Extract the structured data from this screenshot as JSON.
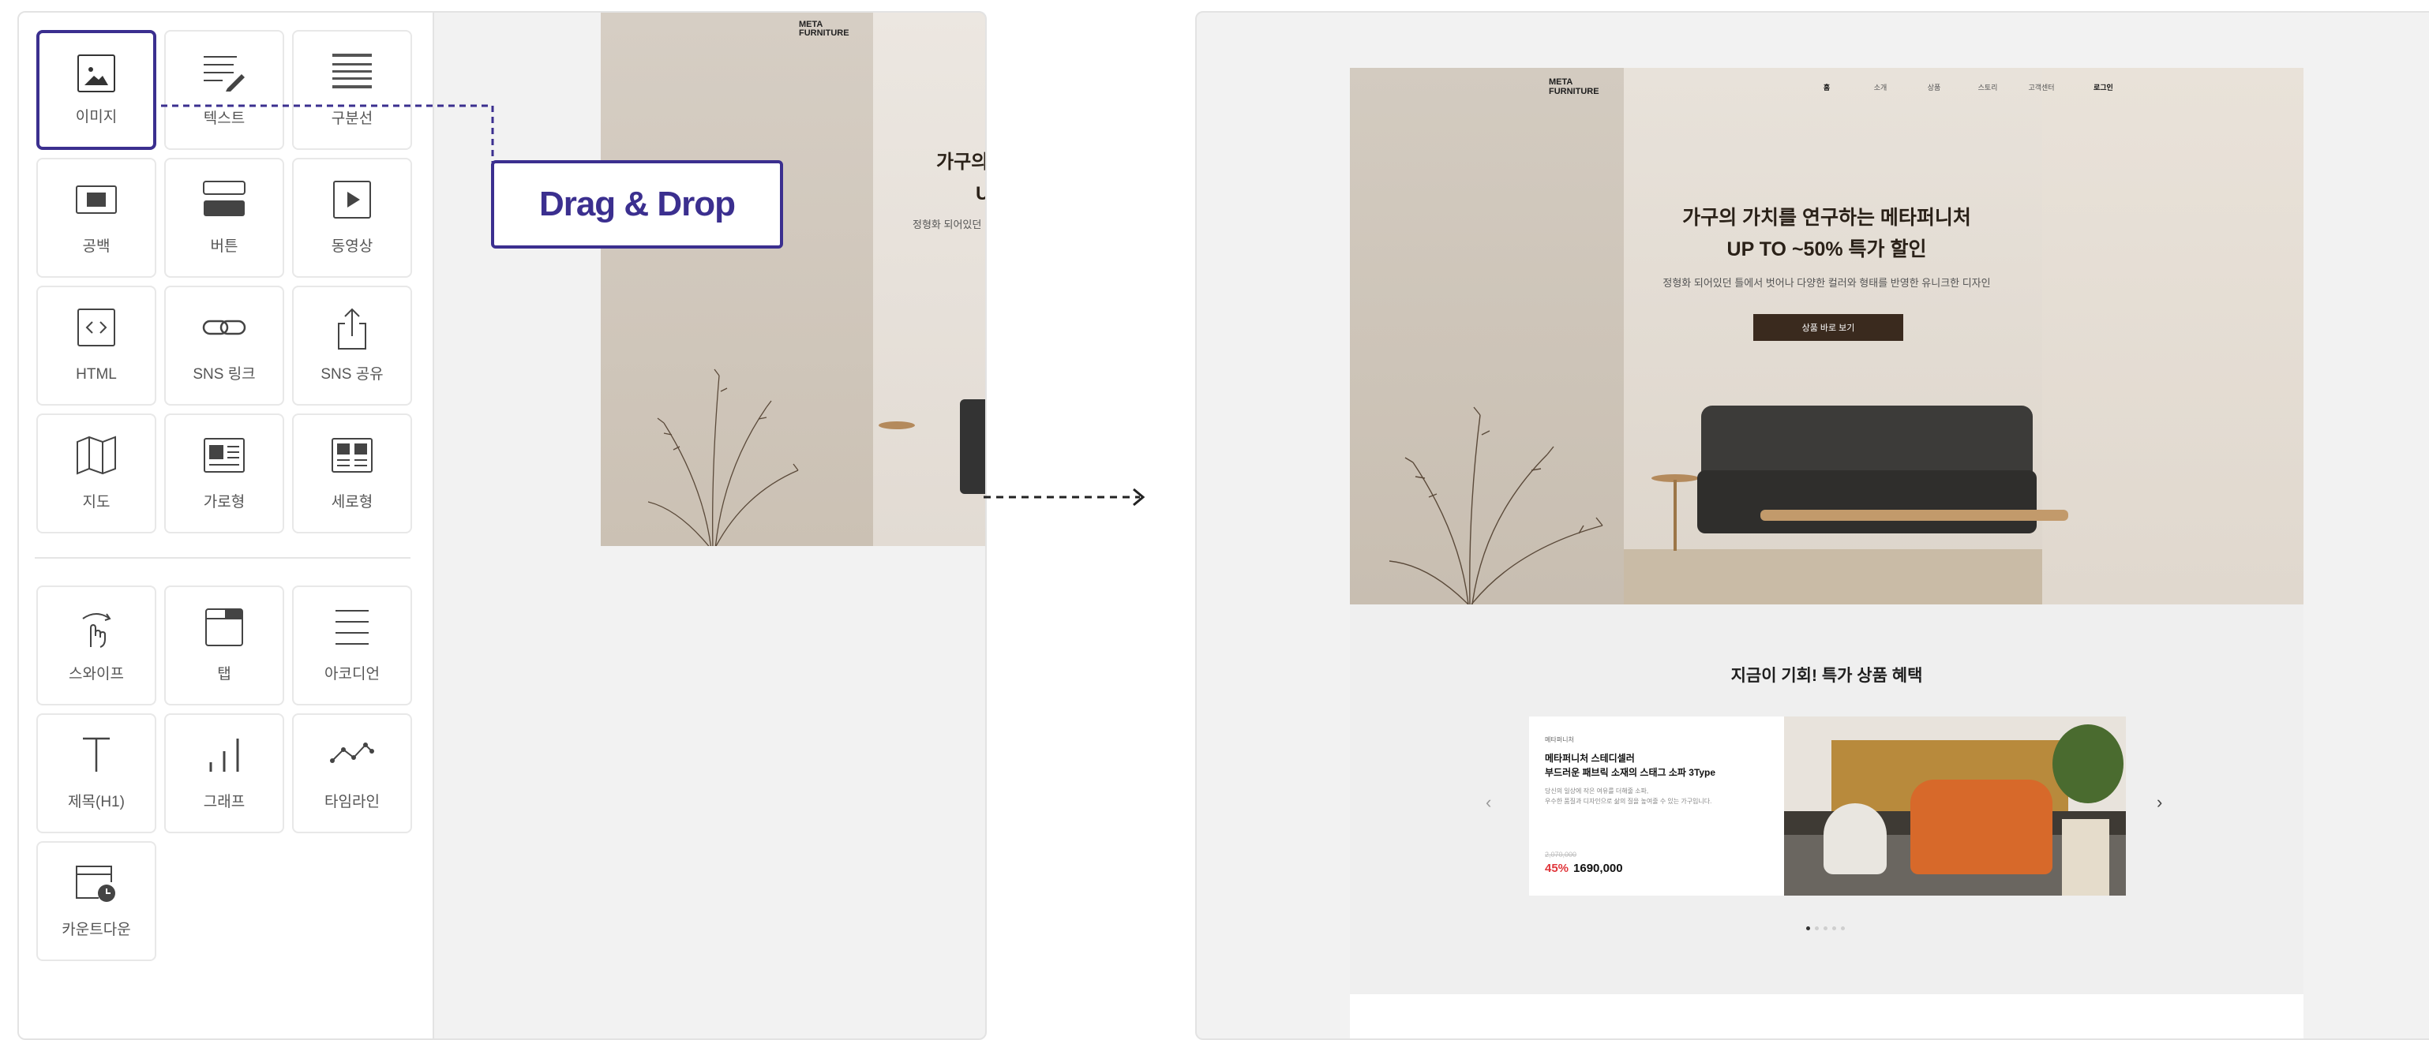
{
  "palette": {
    "tiles": [
      {
        "label": "이미지",
        "icon": "image-icon"
      },
      {
        "label": "텍스트",
        "icon": "text-edit-icon"
      },
      {
        "label": "구분선",
        "icon": "divider-icon"
      },
      {
        "label": "공백",
        "icon": "blank-space-icon"
      },
      {
        "label": "버튼",
        "icon": "button-icon"
      },
      {
        "label": "동영상",
        "icon": "video-play-icon"
      },
      {
        "label": "HTML",
        "icon": "code-icon"
      },
      {
        "label": "SNS 링크",
        "icon": "link-icon"
      },
      {
        "label": "SNS 공유",
        "icon": "share-icon"
      },
      {
        "label": "지도",
        "icon": "map-icon"
      },
      {
        "label": "가로형",
        "icon": "horizontal-card-icon"
      },
      {
        "label": "세로형",
        "icon": "vertical-card-icon"
      },
      {
        "label": "스와이프",
        "icon": "swipe-hand-icon"
      },
      {
        "label": "탭",
        "icon": "tab-icon"
      },
      {
        "label": "아코디언",
        "icon": "accordion-icon"
      },
      {
        "label": "제목(H1)",
        "icon": "heading-icon"
      },
      {
        "label": "그래프",
        "icon": "bar-graph-icon"
      },
      {
        "label": "타임라인",
        "icon": "timeline-icon"
      },
      {
        "label": "카운트다운",
        "icon": "countdown-clock-icon"
      }
    ],
    "selected": "이미지"
  },
  "canvas": {
    "drag_label": "Drag & Drop",
    "preview": {
      "logo_line1": "META",
      "logo_line2": "FURNITURE",
      "head_line1": "가구의",
      "head_line2": "U",
      "sub": "정형화 되어있던"
    }
  },
  "site": {
    "logo_line1": "META",
    "logo_line2": "FURNITURE",
    "nav": [
      "홈",
      "소개",
      "상품",
      "스토리",
      "고객센터"
    ],
    "login": "로그인",
    "hero_title_line1": "가구의 가치를 연구하는 메타퍼니처",
    "hero_title_line2": "UP TO ~50% 특가 할인",
    "hero_sub": "정형화 되어있던 틀에서 벗어나 다양한 컬러와 형태를 반영한 유니크한 디자인",
    "hero_button": "상품 바로 보기",
    "promo_title": "지금이 기회! 특가 상품 혜택",
    "card": {
      "brand": "메타퍼니처",
      "name_line1": "메타퍼니처 스테디셀러",
      "name_line2": "부드러운 패브릭 소재의 스태그 소파 3Type",
      "desc_line1": "당신의 일상에 작은 여유를 더해줄 소파,",
      "desc_line2": "우수한 품질과 디자인으로 삶의 질을 높여줄 수 있는 가구입니다.",
      "original_price": "2,070,000",
      "discount_rate": "45%",
      "price": "1690,000"
    },
    "dots_total": 5,
    "dots_active": 1
  },
  "colors": {
    "accent": "#3b2f8f",
    "hero_button": "#3a2a1e",
    "discount": "#e0363b"
  }
}
